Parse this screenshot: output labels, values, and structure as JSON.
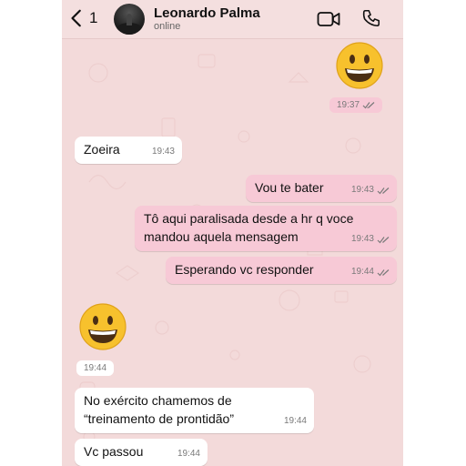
{
  "header": {
    "back_count": "1",
    "contact_name": "Leonardo Palma",
    "status": "online"
  },
  "messages": [
    {
      "type": "emoji",
      "direction": "outgoing",
      "emoji": "grinning-face",
      "time": "19:37",
      "read": true
    },
    {
      "type": "text",
      "direction": "incoming",
      "text": "Zoeira",
      "time": "19:43"
    },
    {
      "type": "text",
      "direction": "outgoing",
      "text": "Vou te bater",
      "time": "19:43",
      "read": true
    },
    {
      "type": "text",
      "direction": "outgoing",
      "lines": [
        "Tô aqui paralisada desde a hr q voce",
        "mandou aquela mensagem"
      ],
      "time": "19:43",
      "read": true
    },
    {
      "type": "text",
      "direction": "outgoing",
      "text": "Esperando vc responder",
      "time": "19:44",
      "read": true
    },
    {
      "type": "emoji",
      "direction": "incoming",
      "emoji": "grinning-face",
      "time": "19:44"
    },
    {
      "type": "text",
      "direction": "incoming",
      "lines": [
        "No exército chamemos de",
        "“treinamento de prontidão”"
      ],
      "time": "19:44"
    },
    {
      "type": "text",
      "direction": "incoming",
      "text": "Vc passou",
      "time": "19:44"
    }
  ],
  "colors": {
    "background": "#f3dada",
    "outgoing_bubble": "#f7c9d6",
    "incoming_bubble": "#ffffff",
    "read_ticks": "#7a7a7a"
  }
}
